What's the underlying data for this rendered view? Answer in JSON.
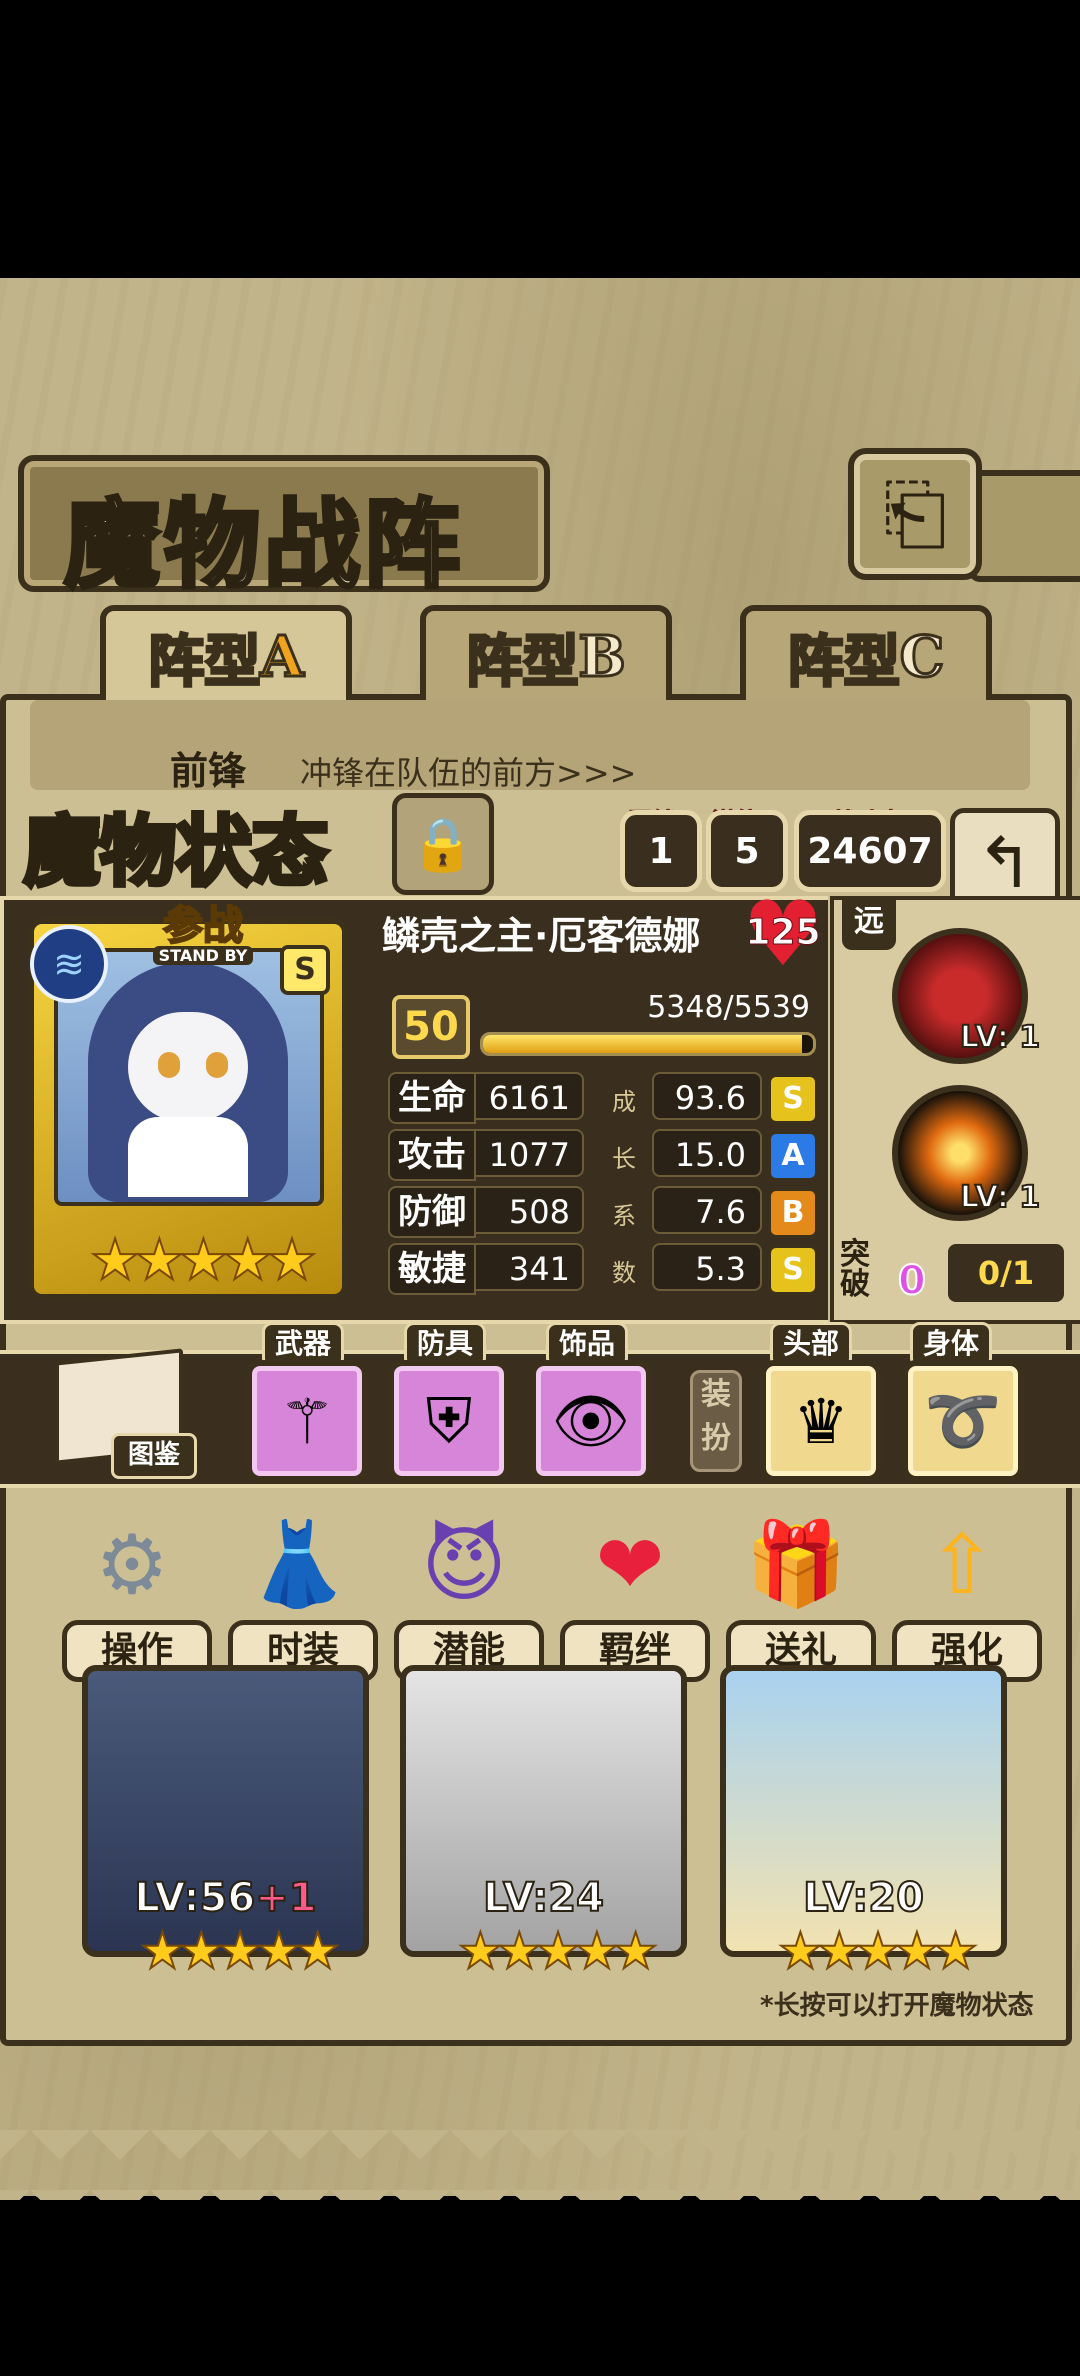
{
  "header": {
    "title": "魔物战阵",
    "back_icon": "⎗"
  },
  "tabs": [
    {
      "prefix": "阵型",
      "letter": "A"
    },
    {
      "prefix": "阵型",
      "letter": "B"
    },
    {
      "prefix": "阵型",
      "letter": "C"
    }
  ],
  "front_row": {
    "label": "前锋",
    "hint": "冲锋在队伍的前方>>>"
  },
  "status": {
    "title": "魔物状态",
    "bond_label": "羁绊",
    "bond_value": "1",
    "potential_label": "潜能",
    "potential_value": "5",
    "power_label": "战斗力",
    "power_value": "24607",
    "return_icon": "↰"
  },
  "character": {
    "standby_cn": "参战",
    "standby_en": "STAND BY",
    "rank": "S",
    "stars": "★★★★★",
    "name": "鳞壳之主·厄客德娜",
    "affection": "125",
    "level": "50",
    "hp_text": "5348/5539",
    "hp_fraction": 0.9655,
    "attributes": [
      {
        "name": "生命",
        "value": "6161",
        "growth_char": "成",
        "growth": "93.6",
        "grade": "S",
        "grade_color": "#e5c21c"
      },
      {
        "name": "攻击",
        "value": "1077",
        "growth_char": "长",
        "growth": "15.0",
        "grade": "A",
        "grade_color": "#2c7ae6"
      },
      {
        "name": "防御",
        "value": "508",
        "growth_char": "系",
        "growth": "7.6",
        "grade": "B",
        "grade_color": "#e38a1a"
      },
      {
        "name": "敏捷",
        "value": "341",
        "growth_char": "数",
        "growth": "5.3",
        "grade": "S",
        "grade_color": "#e5c21c"
      }
    ]
  },
  "skills": {
    "range": "远",
    "skill1_lv": "LV: 1",
    "skill2_lv": "LV: 1",
    "break_label": "突破",
    "break_count": "0",
    "break_progress": "0/1"
  },
  "equipment": {
    "book_label": "图鉴",
    "weapon_label": "武器",
    "armor_label": "防具",
    "accessory_label": "饰品",
    "dress_tag": "装扮",
    "head_label": "头部",
    "body_label": "身体"
  },
  "actions": [
    {
      "label": "操作",
      "icon": "⚙"
    },
    {
      "label": "时装",
      "icon": "👗"
    },
    {
      "label": "潜能",
      "icon": "😈"
    },
    {
      "label": "羁绊",
      "icon": "❤"
    },
    {
      "label": "送礼",
      "icon": "🎁"
    },
    {
      "label": "强化",
      "icon": "⇧"
    }
  ],
  "roster": [
    {
      "lv": "LV:56",
      "plus": "+1",
      "stars": "★★★★★"
    },
    {
      "lv": "LV:24",
      "plus": "",
      "stars": "★★★★★"
    },
    {
      "lv": "LV:20",
      "plus": "",
      "stars": "★★★★★"
    }
  ],
  "footer_hint": "*长按可以打开魔物状态",
  "colors": {
    "parchment": "#c2b48a",
    "dark_panel": "#3a2f1e",
    "outline": "#3b301c",
    "gold": "#ffd94d"
  }
}
